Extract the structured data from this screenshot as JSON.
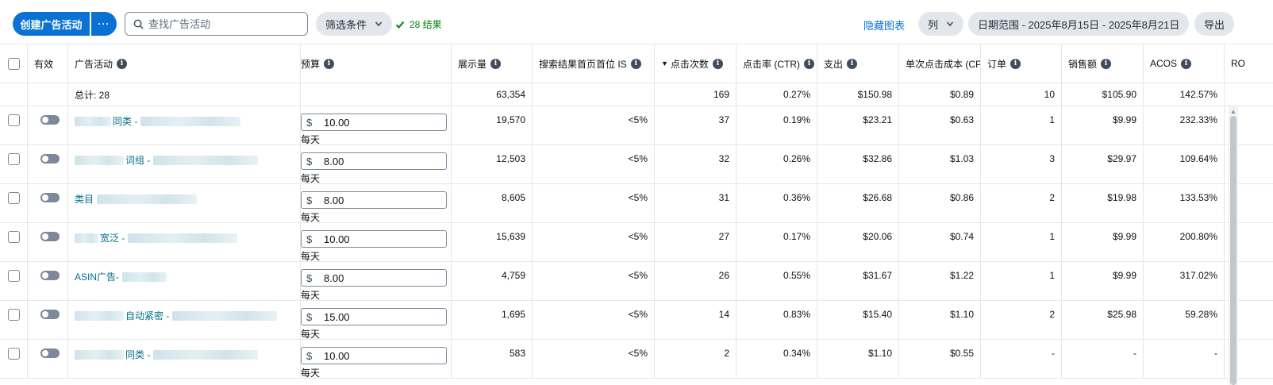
{
  "toolbar": {
    "create_label": "创建广告活动",
    "more_label": "···",
    "search_placeholder": "查找广告活动",
    "filter_label": "筛选条件",
    "results_label": "28 结果",
    "hide_chart_label": "隐藏图表",
    "columns_label": "列",
    "date_range_label": "日期范围 - 2025年8月15日 - 2025年8月21日",
    "export_label": "导出"
  },
  "columns": {
    "active": "有效",
    "campaign": "广告活动",
    "budget": "预算",
    "impressions": "展示量",
    "top_is": "搜索结果首页首位 IS",
    "clicks": "点击次数",
    "ctr": "点击率 (CTR)",
    "spend": "支出",
    "cpc": "单次点击成本 (CPC)",
    "orders": "订单",
    "sales": "销售额",
    "acos": "ACOS",
    "roas": "RO"
  },
  "totals": {
    "label": "总计: 28",
    "impressions": "63,354",
    "clicks": "169",
    "ctr": "0.27%",
    "spend": "$150.98",
    "cpc": "$0.89",
    "orders": "10",
    "sales": "$105.90",
    "acos": "142.57%"
  },
  "budget_currency": "$",
  "budget_period": "每天",
  "rows": [
    {
      "name": "同类 -",
      "budget": "10.00",
      "impressions": "19,570",
      "top_is": "<5%",
      "clicks": "37",
      "ctr": "0.19%",
      "spend": "$23.21",
      "cpc": "$0.63",
      "orders": "1",
      "sales": "$9.99",
      "acos": "232.33%"
    },
    {
      "name": "词组 -",
      "budget": "8.00",
      "impressions": "12,503",
      "top_is": "<5%",
      "clicks": "32",
      "ctr": "0.26%",
      "spend": "$32.86",
      "cpc": "$1.03",
      "orders": "3",
      "sales": "$29.97",
      "acos": "109.64%"
    },
    {
      "name": "类目",
      "budget": "8.00",
      "impressions": "8,605",
      "top_is": "<5%",
      "clicks": "31",
      "ctr": "0.36%",
      "spend": "$26.68",
      "cpc": "$0.86",
      "orders": "2",
      "sales": "$19.98",
      "acos": "133.53%"
    },
    {
      "name": "宽泛 -",
      "budget": "10.00",
      "impressions": "15,639",
      "top_is": "<5%",
      "clicks": "27",
      "ctr": "0.17%",
      "spend": "$20.06",
      "cpc": "$0.74",
      "orders": "1",
      "sales": "$9.99",
      "acos": "200.80%"
    },
    {
      "name": "ASIN广告-",
      "budget": "8.00",
      "impressions": "4,759",
      "top_is": "<5%",
      "clicks": "26",
      "ctr": "0.55%",
      "spend": "$31.67",
      "cpc": "$1.22",
      "orders": "1",
      "sales": "$9.99",
      "acos": "317.02%"
    },
    {
      "name": "自动紧密 -",
      "budget": "15.00",
      "impressions": "1,695",
      "top_is": "<5%",
      "clicks": "14",
      "ctr": "0.83%",
      "spend": "$15.40",
      "cpc": "$1.10",
      "orders": "2",
      "sales": "$25.98",
      "acos": "59.28%"
    },
    {
      "name": "同类 -",
      "budget": "10.00",
      "impressions": "583",
      "top_is": "<5%",
      "clicks": "2",
      "ctr": "0.34%",
      "spend": "$1.10",
      "cpc": "$0.55",
      "orders": "-",
      "sales": "-",
      "acos": "-"
    }
  ]
}
